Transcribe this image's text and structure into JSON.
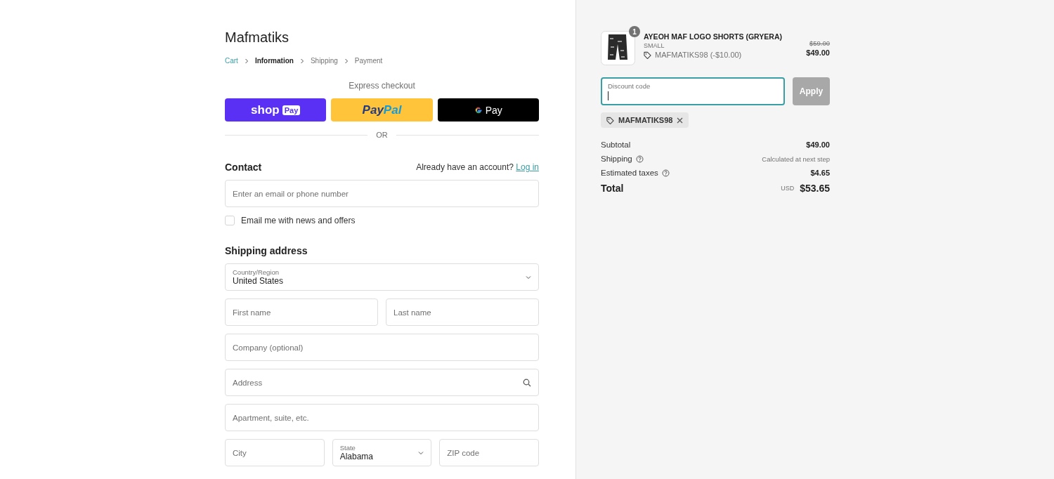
{
  "store": {
    "name": "Mafmatiks"
  },
  "breadcrumb": [
    {
      "label": "Cart",
      "kind": "link",
      "selected": false
    },
    {
      "label": "Information",
      "kind": "step",
      "selected": true
    },
    {
      "label": "Shipping",
      "kind": "step",
      "selected": false
    },
    {
      "label": "Payment",
      "kind": "step",
      "selected": false
    }
  ],
  "express_checkout": {
    "title": "Express checkout",
    "buttons": [
      {
        "kind": "shop_pay",
        "label": "shop",
        "badge": "Pay"
      },
      {
        "kind": "paypal",
        "label": "Pay",
        "label_2": "Pal"
      },
      {
        "kind": "google_pay",
        "label": "Pay"
      }
    ],
    "divider": "OR"
  },
  "contact": {
    "heading": "Contact",
    "prompt": "Already have an account?",
    "link": "Log in",
    "email_placeholder": "Enter an email or phone number",
    "newsletter": {
      "label": "Email me with news and offers",
      "checked": false
    }
  },
  "shipping_address": {
    "heading": "Shipping address",
    "rows": [
      [
        {
          "kind": "select",
          "label": "Country/Region",
          "value": "United States"
        }
      ],
      [
        {
          "kind": "text",
          "placeholder": "First name"
        },
        {
          "kind": "text",
          "placeholder": "Last name"
        }
      ],
      [
        {
          "kind": "text",
          "placeholder": "Company (optional)"
        }
      ],
      [
        {
          "kind": "search",
          "placeholder": "Address"
        }
      ],
      [
        {
          "kind": "text",
          "placeholder": "Apartment, suite, etc."
        }
      ],
      [
        {
          "kind": "text",
          "placeholder": "City"
        },
        {
          "kind": "select",
          "label": "State",
          "value": "Alabama"
        },
        {
          "kind": "text",
          "placeholder": "ZIP code"
        }
      ]
    ]
  },
  "summary": {
    "item": {
      "kind": "picture",
      "quantity": "1",
      "name": "AYEOH MAF LOGO SHORTS (GRYERA)",
      "variant": "SMALL",
      "discount": "MAFMATIKS98 (-$10.00)",
      "original_price": "$59.00",
      "price": "$49.00"
    },
    "discount": {
      "label": "Discount code",
      "focused": true,
      "button": "Apply",
      "button_disabled": true
    },
    "applied_codes": [
      {
        "code": "MAFMATIKS98"
      }
    ],
    "lines": [
      {
        "label": "Subtotal",
        "help": false,
        "value": "$49.00",
        "kind": "amount"
      },
      {
        "label": "Shipping",
        "help": true,
        "value": "Calculated at next step",
        "kind": "note"
      },
      {
        "label": "Estimated taxes",
        "help": true,
        "value": "$4.65",
        "kind": "amount"
      }
    ],
    "total": {
      "label": "Total",
      "currency": "USD",
      "value": "$53.65"
    }
  }
}
